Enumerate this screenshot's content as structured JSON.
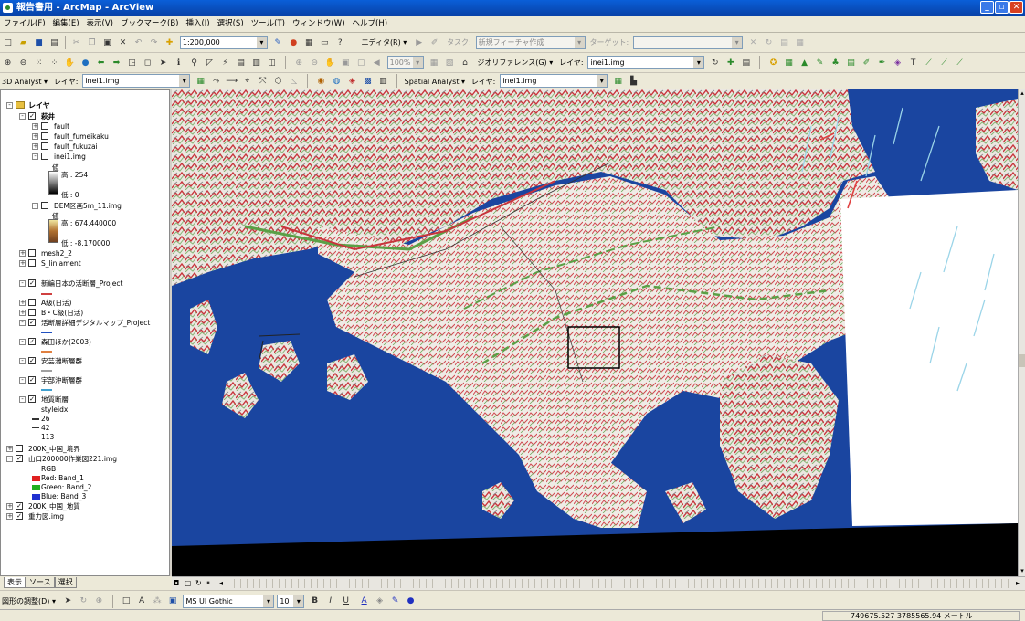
{
  "window": {
    "title": "報告書用 - ArcMap - ArcView"
  },
  "menu": [
    "ファイル(F)",
    "編集(E)",
    "表示(V)",
    "ブックマーク(B)",
    "挿入(I)",
    "選択(S)",
    "ツール(T)",
    "ウィンドウ(W)",
    "ヘルプ(H)"
  ],
  "standard": {
    "scale": "1:200,000",
    "editor_label": "エディタ(R) ▾",
    "task_label": "タスク:",
    "task_value": "新規フィーチャ作成",
    "target_label": "ターゲット:",
    "target_value": ""
  },
  "tools": {
    "zoom_value": "100%",
    "georef_label": "ジオリファレンス(G) ▾",
    "layer_label": "レイヤ:",
    "layer_value": "inei1.img"
  },
  "analyst": {
    "label_3d": "3D Analyst ▾",
    "layer_label": "レイヤ:",
    "layer_value": "inei1.img",
    "spatial_label": "Spatial Analyst ▾",
    "spatial_layer_label": "レイヤ:",
    "spatial_layer_value": "inei1.img"
  },
  "toc": {
    "root": "レイヤ",
    "rows": [
      {
        "text": "萩井",
        "exp": "-",
        "chk": "✓",
        "indent": 1,
        "bold": true
      },
      {
        "text": "fault",
        "exp": "+",
        "chk": "",
        "indent": 2
      },
      {
        "text": "fault_fumeikaku",
        "exp": "+",
        "chk": "",
        "indent": 2
      },
      {
        "text": "fault_fukuzai",
        "exp": "+",
        "chk": "",
        "indent": 2
      },
      {
        "text": "inei1.img",
        "exp": "-",
        "chk": "",
        "indent": 2
      }
    ],
    "inei_value": "値",
    "inei_high": "高 : 254",
    "inei_low": "低 : 0",
    "dem_name": "DEM区画5m_11.img",
    "dem_value": "値",
    "dem_high": "高 : 674.440000",
    "dem_low": "低 : -8.170000",
    "mesh": "mesh2_2",
    "liniament": "S_liniament",
    "shinpen": "新編日本の活断層_Project",
    "a_grade": "A級(日活)",
    "bc_grade": "B・C級(日活)",
    "katsudanso": "活断層詳細デジタルマップ_Project",
    "moriyama": "森田ほか(2003)",
    "ube1": "安芸灘断層群",
    "ube2": "宇部沖断層群",
    "chishitsu": "地質断層",
    "styleidx": "styleidx",
    "legend_26": "26",
    "legend_42": "42",
    "legend_113": "113",
    "chugoku_kyokai": "200K_中国_境界",
    "yamaguchi": "山口200000作業図221.img",
    "rgb": "RGB",
    "red": "Red:    Band_1",
    "green": "Green: Band_2",
    "blue": "Blue:   Band_3",
    "chugoku_chishitsu": "200K_中国_地質",
    "juryoku": "重力図.img"
  },
  "tabs": [
    "表示",
    "ソース",
    "選択"
  ],
  "draw": {
    "label": "図形の調整(D) ▾",
    "font": "MS UI Gothic",
    "size": "10"
  },
  "status": {
    "coords": "749675.527  3785565.94 メートル"
  },
  "colors": {
    "sea": "#1a45a0",
    "land": "#ece8e2",
    "ridge_red": "#c8343c",
    "ridge_green": "#5aa046"
  }
}
